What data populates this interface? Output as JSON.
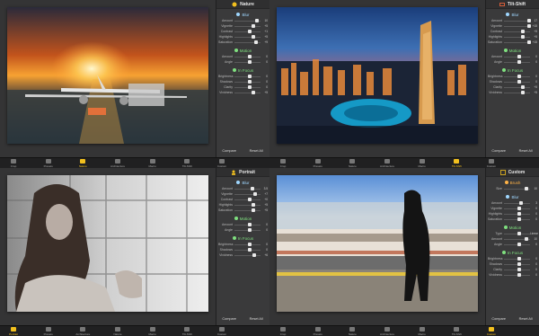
{
  "quadrants": [
    {
      "panel_title": "Nature",
      "title_color": "#f2c01e",
      "photo_desc": "sunset-airport-plane",
      "sections": [
        {
          "label": "Blur",
          "color": "#9fd7ff",
          "rows": [
            {
              "label": "Amount",
              "value": "10"
            },
            {
              "label": "Vignette",
              "value": "+5"
            },
            {
              "label": "Contrast",
              "value": "+1"
            },
            {
              "label": "Highlights",
              "value": "+5"
            },
            {
              "label": "Saturation",
              "value": "+9"
            }
          ]
        },
        {
          "label": "Motion",
          "color": "#7fe07f",
          "rows": [
            {
              "label": "Amount",
              "value": "0"
            },
            {
              "label": "Angle",
              "value": "0"
            }
          ]
        },
        {
          "label": "In Focus",
          "color": "#7fe07f",
          "rows": [
            {
              "label": "Brightness",
              "value": "0"
            },
            {
              "label": "Shadows",
              "value": "0"
            },
            {
              "label": "Clarity",
              "value": "0"
            },
            {
              "label": "Vividness",
              "value": "+5"
            }
          ]
        }
      ],
      "compare": "Compare",
      "reset": "Reset All",
      "toolbar": [
        "Crop",
        "Presets",
        "Nature",
        "Architecture",
        "Macro",
        "Tilt-Shift",
        "Custom"
      ],
      "active_tool": 2
    },
    {
      "panel_title": "Tilt-Shift",
      "title_color": "#ff6a3d",
      "photo_desc": "dubai-marina-night",
      "sections": [
        {
          "label": "Blur",
          "color": "#9fd7ff",
          "rows": [
            {
              "label": "Amount",
              "value": "17"
            },
            {
              "label": "Vignette",
              "value": "+15"
            },
            {
              "label": "Contrast",
              "value": "+5"
            },
            {
              "label": "Highlights",
              "value": "+5"
            },
            {
              "label": "Saturation",
              "value": "+15"
            }
          ]
        },
        {
          "label": "Motion",
          "color": "#7fe07f",
          "rows": [
            {
              "label": "Amount",
              "value": "0"
            },
            {
              "label": "Angle",
              "value": "0"
            }
          ]
        },
        {
          "label": "In Focus",
          "color": "#7fe07f",
          "rows": [
            {
              "label": "Brightness",
              "value": "0"
            },
            {
              "label": "Shadows",
              "value": "0"
            },
            {
              "label": "Clarity",
              "value": "+5"
            },
            {
              "label": "Vividness",
              "value": "+5"
            }
          ]
        }
      ],
      "compare": "Compare",
      "reset": "Reset All",
      "toolbar": [
        "Crop",
        "Presets",
        "Nature",
        "Architecture",
        "Macro",
        "Tilt-Shift",
        "Custom"
      ],
      "active_tool": 5
    },
    {
      "panel_title": "Portrait",
      "title_color": "#f2c01e",
      "photo_desc": "bw-portrait-window",
      "sections": [
        {
          "label": "Blur",
          "color": "#9fd7ff",
          "rows": [
            {
              "label": "Amount",
              "value": "3.5"
            },
            {
              "label": "Vignette",
              "value": "+7"
            },
            {
              "label": "Contrast",
              "value": "+0"
            },
            {
              "label": "Highlights",
              "value": "+5"
            },
            {
              "label": "Saturation",
              "value": "+5"
            }
          ]
        },
        {
          "label": "Motion",
          "color": "#7fe07f",
          "rows": [
            {
              "label": "Amount",
              "value": "0"
            },
            {
              "label": "Angle",
              "value": "0"
            }
          ]
        },
        {
          "label": "In Focus",
          "color": "#7fe07f",
          "rows": [
            {
              "label": "Brightness",
              "value": "0"
            },
            {
              "label": "Shadows",
              "value": "0"
            },
            {
              "label": "Vividness",
              "value": "+6"
            }
          ]
        }
      ],
      "compare": "Compare",
      "reset": "Reset All",
      "toolbar": [
        "Portrait",
        "Presets",
        "Architecture",
        "Nature",
        "Macro",
        "Tilt-Shift",
        "Custom"
      ],
      "active_tool": 0
    },
    {
      "panel_title": "Custom",
      "title_color": "#f2c01e",
      "photo_desc": "train-motion-blur-silhouette",
      "sections": [
        {
          "label": "Brush",
          "color": "#ffb347",
          "rows": [
            {
              "label": "Size",
              "value": "10"
            }
          ]
        },
        {
          "label": "Blur",
          "color": "#9fd7ff",
          "rows": [
            {
              "label": "Amount",
              "value": "3"
            },
            {
              "label": "Vignette",
              "value": "0"
            },
            {
              "label": "Highlights",
              "value": "0"
            },
            {
              "label": "Saturation",
              "value": "0"
            }
          ]
        },
        {
          "label": "Motion",
          "color": "#7fe07f",
          "rows": [
            {
              "label": "Type",
              "value": "Linear"
            },
            {
              "label": "Amount",
              "value": "10"
            },
            {
              "label": "Angle",
              "value": "0"
            }
          ]
        },
        {
          "label": "In Focus",
          "color": "#7fe07f",
          "rows": [
            {
              "label": "Brightness",
              "value": "0"
            },
            {
              "label": "Shadows",
              "value": "0"
            },
            {
              "label": "Clarity",
              "value": "0"
            },
            {
              "label": "Vividness",
              "value": "0"
            }
          ]
        }
      ],
      "compare": "Compare",
      "reset": "Reset All",
      "toolbar": [
        "Crop",
        "Presets",
        "Nature",
        "Architecture",
        "Macro",
        "Tilt-Shift",
        "Custom"
      ],
      "active_tool": 6
    }
  ]
}
